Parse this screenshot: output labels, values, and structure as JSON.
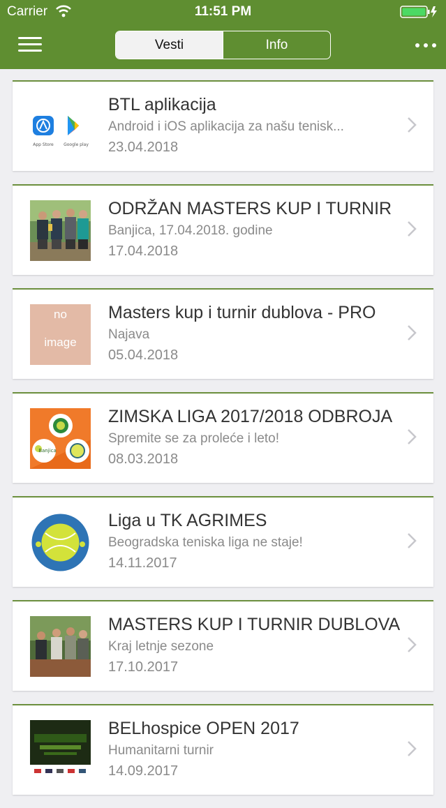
{
  "status": {
    "carrier": "Carrier",
    "time": "11:51 PM"
  },
  "nav": {
    "segments": [
      {
        "label": "Vesti",
        "active": true
      },
      {
        "label": "Info",
        "active": false
      }
    ]
  },
  "colors": {
    "header": "#5f8e31",
    "card_accent": "#6b8f3d",
    "background": "#efeff2"
  },
  "news": [
    {
      "title": "BTL aplikacija",
      "subtitle": "Android i iOS aplikacija za našu tenisk...",
      "date": "23.04.2018",
      "thumb": "app-store-google-play-icons"
    },
    {
      "title": "ODRŽAN MASTERS KUP I TURNIR",
      "subtitle": "Banjica, 17.04.2018. godine",
      "date": "17.04.2018",
      "thumb": "group-photo"
    },
    {
      "title": "Masters kup i turnir dublova - PRO",
      "subtitle": "Najava",
      "date": "05.04.2018",
      "thumb": "no-image-placeholder",
      "thumb_text": [
        "no",
        "image"
      ]
    },
    {
      "title": "ZIMSKA LIGA 2017/2018 ODBROJA",
      "subtitle": "Spremite se za proleće i leto!",
      "date": "08.03.2018",
      "thumb": "club-logos-orange"
    },
    {
      "title": "Liga u TK AGRIMES",
      "subtitle": "Beogradska teniska liga ne staje!",
      "date": "14.11.2017",
      "thumb": "teniski-klub-agrimes-logo"
    },
    {
      "title": "MASTERS KUP I TURNIR DUBLOVA",
      "subtitle": "Kraj letnje sezone",
      "date": "17.10.2017",
      "thumb": "group-photo"
    },
    {
      "title": "BELhospice OPEN 2017",
      "subtitle": "Humanitarni turnir",
      "date": "14.09.2017",
      "thumb": "event-poster"
    }
  ]
}
